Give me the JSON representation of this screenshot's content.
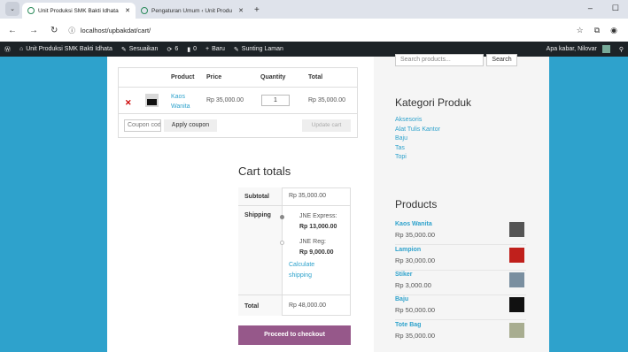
{
  "browser": {
    "tabs": [
      {
        "title": "Unit Produksi SMK Bakti Idhata",
        "active": true
      },
      {
        "title": "Pengaturan Umum ‹ Unit Produ",
        "active": false
      }
    ],
    "new_tab": "+",
    "url": "localhost/upbakdat/cart/",
    "window_controls": [
      "–",
      "☐"
    ]
  },
  "adminbar": {
    "site": "Unit Produksi SMK Bakti Idhata",
    "customize": "Sesuaikan",
    "updates": "6",
    "comments": "0",
    "new": "Baru",
    "edit": "Sunting Laman",
    "greeting": "Apa kabar, Nilovar"
  },
  "search": {
    "placeholder": "Search products...",
    "button": "Search"
  },
  "cart": {
    "headers": [
      "Product",
      "Price",
      "Quantity",
      "Total"
    ],
    "item": {
      "name_line1": "Kaos",
      "name_line2": "Wanita",
      "price": "Rp 35,000.00",
      "quantity": "1",
      "total": "Rp 35,000.00"
    },
    "coupon_placeholder": "Coupon code",
    "apply_coupon": "Apply coupon",
    "update_cart": "Update cart"
  },
  "cart_totals": {
    "title": "Cart totals",
    "subtotal_label": "Subtotal",
    "subtotal": "Rp 35,000.00",
    "shipping_label": "Shipping",
    "options": [
      {
        "name": "JNE Express:",
        "price": "Rp 13,000.00",
        "selected": true
      },
      {
        "name": "JNE Reg:",
        "price": "Rp 9,000.00",
        "selected": false
      }
    ],
    "calc_line1": "Calculate",
    "calc_line2": "shipping",
    "total_label": "Total",
    "total": "Rp 48,000.00",
    "checkout": "Proceed to checkout"
  },
  "sidebar": {
    "categories_title": "Kategori Produk",
    "categories": [
      "Aksesoris",
      "Alat Tulis Kantor",
      "Baju",
      "Tas",
      "Topi"
    ],
    "products_title": "Products",
    "products": [
      {
        "name": "Kaos Wanita",
        "price": "Rp 35,000.00",
        "color": "#555555"
      },
      {
        "name": "Lampion",
        "price": "Rp 30,000.00",
        "color": "#c0201c"
      },
      {
        "name": "Stiker",
        "price": "Rp 3,000.00",
        "color": "#7a8fa0"
      },
      {
        "name": "Baju",
        "price": "Rp 50,000.00",
        "color": "#111111"
      },
      {
        "name": "Tote Bag",
        "price": "Rp 35,000.00",
        "color": "#a8ad90"
      }
    ]
  }
}
